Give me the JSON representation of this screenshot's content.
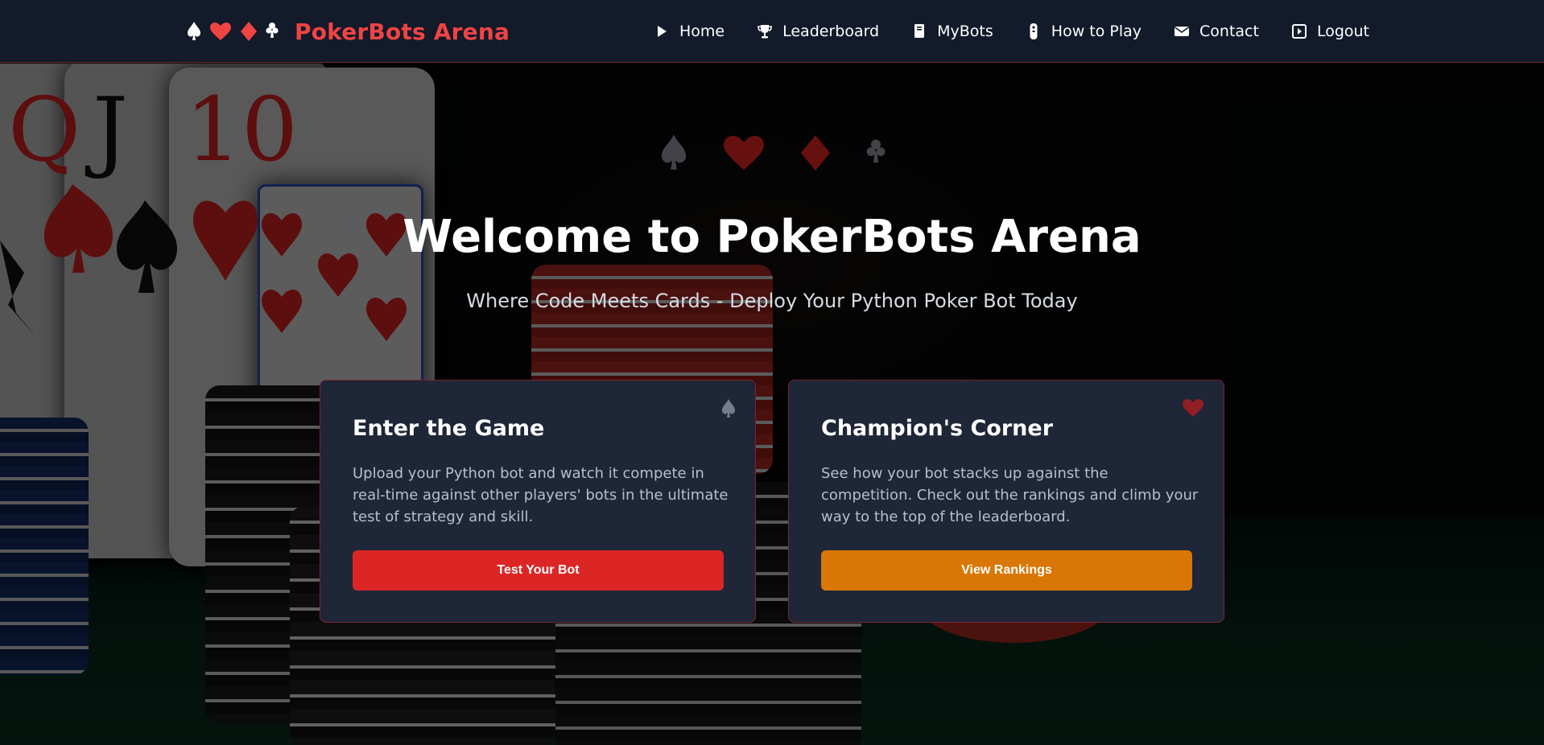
{
  "brand": {
    "title": "PokerBots Arena",
    "suit_icons": [
      "spade-icon",
      "heart-icon",
      "diamond-icon",
      "club-icon"
    ]
  },
  "nav": {
    "items": [
      {
        "label": "Home",
        "icon": "play-icon"
      },
      {
        "label": "Leaderboard",
        "icon": "trophy-icon"
      },
      {
        "label": "MyBots",
        "icon": "book-icon"
      },
      {
        "label": "How to Play",
        "icon": "remote-icon"
      },
      {
        "label": "Contact",
        "icon": "mail-icon"
      },
      {
        "label": "Logout",
        "icon": "logout-icon"
      }
    ]
  },
  "hero": {
    "title": "Welcome to PokerBots Arena",
    "subtitle": "Where Code Meets Cards - Deploy Your Python Poker Bot Today"
  },
  "cards": [
    {
      "title": "Enter the Game",
      "text": "Upload your Python bot and watch it compete in real-time against other players' bots in the ultimate test of strategy and skill.",
      "button": "Test Your Bot",
      "icon": "spade-icon"
    },
    {
      "title": "Champion's Corner",
      "text": "See how your bot stacks up against the competition. Check out the rankings and climb your way to the top of the leaderboard.",
      "button": "View Rankings",
      "icon": "heart-icon"
    }
  ],
  "colors": {
    "brand_red": "#ef4444",
    "nav_bg": "#131a2a",
    "card_bg": "#1e2638",
    "btn_red": "#dc2626",
    "btn_orange": "#d97706"
  }
}
